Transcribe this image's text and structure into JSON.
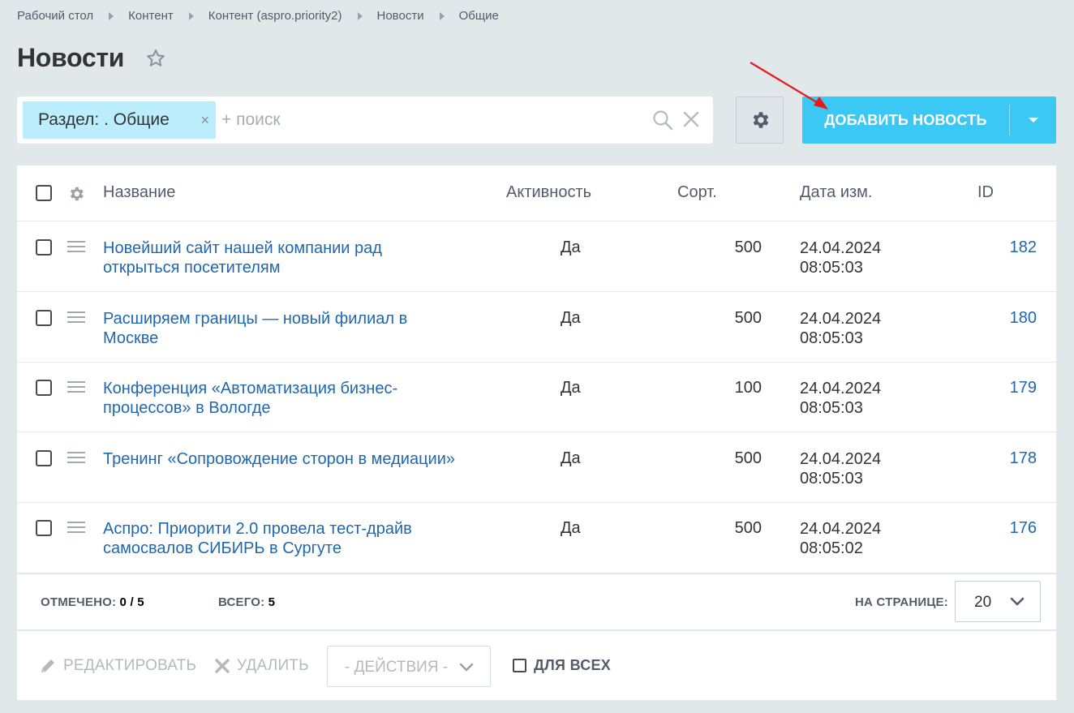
{
  "breadcrumb": [
    "Рабочий стол",
    "Контент",
    "Контент (aspro.priority2)",
    "Новости",
    "Общие"
  ],
  "page_title": "Новости",
  "filter": {
    "tag_label": "Раздел: . Общие",
    "tag_close": "×",
    "search_placeholder": "+ поиск"
  },
  "add_button": {
    "label": "ДОБАВИТЬ НОВОСТЬ"
  },
  "table": {
    "columns": {
      "name": "Название",
      "active": "Активность",
      "sort": "Сорт.",
      "date": "Дата изм.",
      "id": "ID"
    },
    "rows": [
      {
        "name": "Новейший сайт нашей компании рад открыться посетителям",
        "active": "Да",
        "sort": "500",
        "date": "24.04.2024",
        "time": "08:05:03",
        "id": "182"
      },
      {
        "name": "Расширяем границы — новый филиал в Москве",
        "active": "Да",
        "sort": "500",
        "date": "24.04.2024",
        "time": "08:05:03",
        "id": "180"
      },
      {
        "name": "Конференция «Автоматизация бизнес-процессов» в Вологде",
        "active": "Да",
        "sort": "100",
        "date": "24.04.2024",
        "time": "08:05:03",
        "id": "179"
      },
      {
        "name": "Тренинг «Сопровождение сторон в медиации»",
        "active": "Да",
        "sort": "500",
        "date": "24.04.2024",
        "time": "08:05:03",
        "id": "178"
      },
      {
        "name": "Аспро: Приорити 2.0 провела тест-драйв самосвалов СИБИРЬ в Сургуте",
        "active": "Да",
        "sort": "500",
        "date": "24.04.2024",
        "time": "08:05:02",
        "id": "176"
      }
    ]
  },
  "footer": {
    "selected_label": "ОТМЕЧЕНО:",
    "selected_value": "0 / 5",
    "total_label": "ВСЕГО:",
    "total_value": "5",
    "per_page_label": "НА СТРАНИЦЕ:",
    "per_page_value": "20"
  },
  "actions": {
    "edit_label": "РЕДАКТИРОВАТЬ",
    "delete_label": "УДАЛИТЬ",
    "actions_select": "- ДЕЙСТВИЯ -",
    "for_all_label": "ДЛЯ ВСЕХ"
  },
  "colors": {
    "accent": "#3bc8f5",
    "link": "#2067b0",
    "filter_tag": "#bcedfc",
    "background": "#e1e8ea",
    "annotation_arrow": "#e8191e"
  },
  "icons": [
    "star-icon",
    "search-icon",
    "clear-icon",
    "gear-icon",
    "caret-down-icon",
    "drag-handle-icon",
    "pencil-icon",
    "cross-icon",
    "chevron-down-icon"
  ]
}
